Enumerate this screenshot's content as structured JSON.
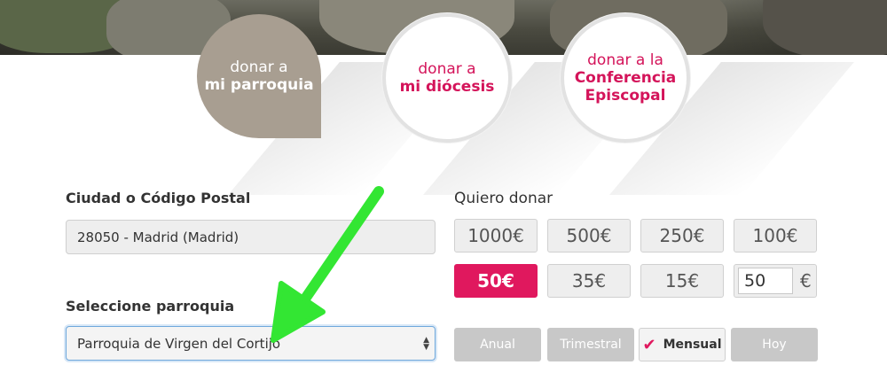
{
  "tabs": [
    {
      "line1": "donar a",
      "line2": "mi parroquia",
      "active": true
    },
    {
      "line1": "donar a",
      "line2": "mi diócesis",
      "active": false
    },
    {
      "line1": "donar a la",
      "line2": "Conferencia",
      "line3": "Episcopal",
      "active": false
    }
  ],
  "location": {
    "label": "Ciudad o Código Postal",
    "value": "28050 - Madrid (Madrid)"
  },
  "parish": {
    "label": "Seleccione parroquia",
    "selected": "Parroquia de Virgen del Cortijo"
  },
  "donation": {
    "label": "Quiero donar",
    "amounts": [
      "1000€",
      "500€",
      "250€",
      "100€",
      "50€",
      "35€",
      "15€"
    ],
    "selected_amount": "50€",
    "custom_value": "50",
    "currency": "€"
  },
  "frequency": {
    "options": [
      "Anual",
      "Trimestral",
      "Mensual",
      "Hoy"
    ],
    "selected": "Mensual",
    "check_glyph": "✔"
  },
  "colors": {
    "accent": "#e0185e",
    "active_tab": "#a89e91",
    "annotation_arrow": "#33e633"
  }
}
